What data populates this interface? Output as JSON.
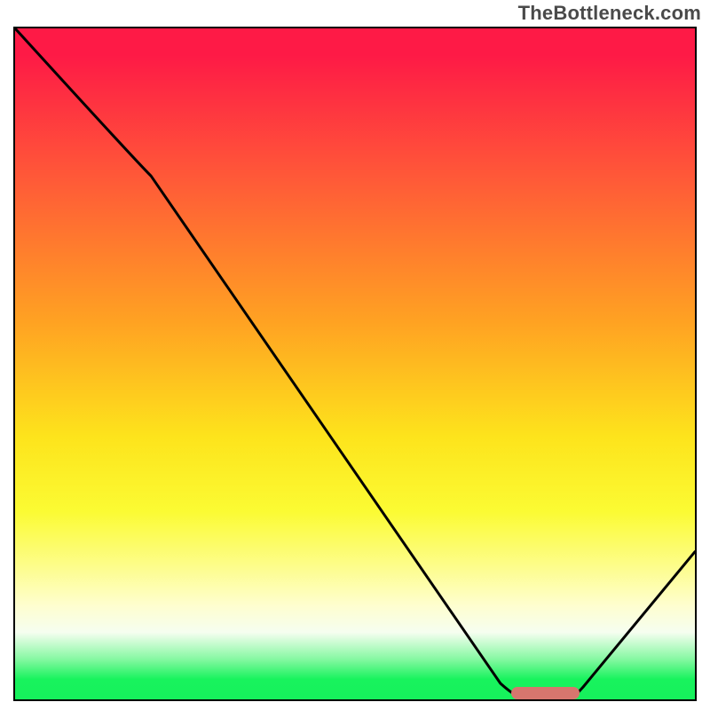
{
  "watermark": "TheBottleneck.com",
  "chart_data": {
    "type": "line",
    "title": "",
    "xlabel": "",
    "ylabel": "",
    "xlim": [
      0,
      100
    ],
    "ylim": [
      0,
      100
    ],
    "grid": false,
    "series": [
      {
        "name": "bottleneck-curve",
        "x": [
          0,
          20,
          74,
          82,
          100
        ],
        "values": [
          100,
          78,
          0,
          0,
          22
        ]
      }
    ],
    "annotations": [
      {
        "name": "optimal-range-marker",
        "x_start": 73,
        "x_end": 83,
        "y": 0,
        "color": "#d6766e"
      }
    ],
    "background_gradient": {
      "top": "#fe1a46",
      "mid_high": "#ffa322",
      "mid": "#fde41c",
      "mid_low": "#fdfd89",
      "bottom": "#16f15c"
    }
  },
  "marker": {
    "left_pct": 73,
    "width_pct": 10
  }
}
